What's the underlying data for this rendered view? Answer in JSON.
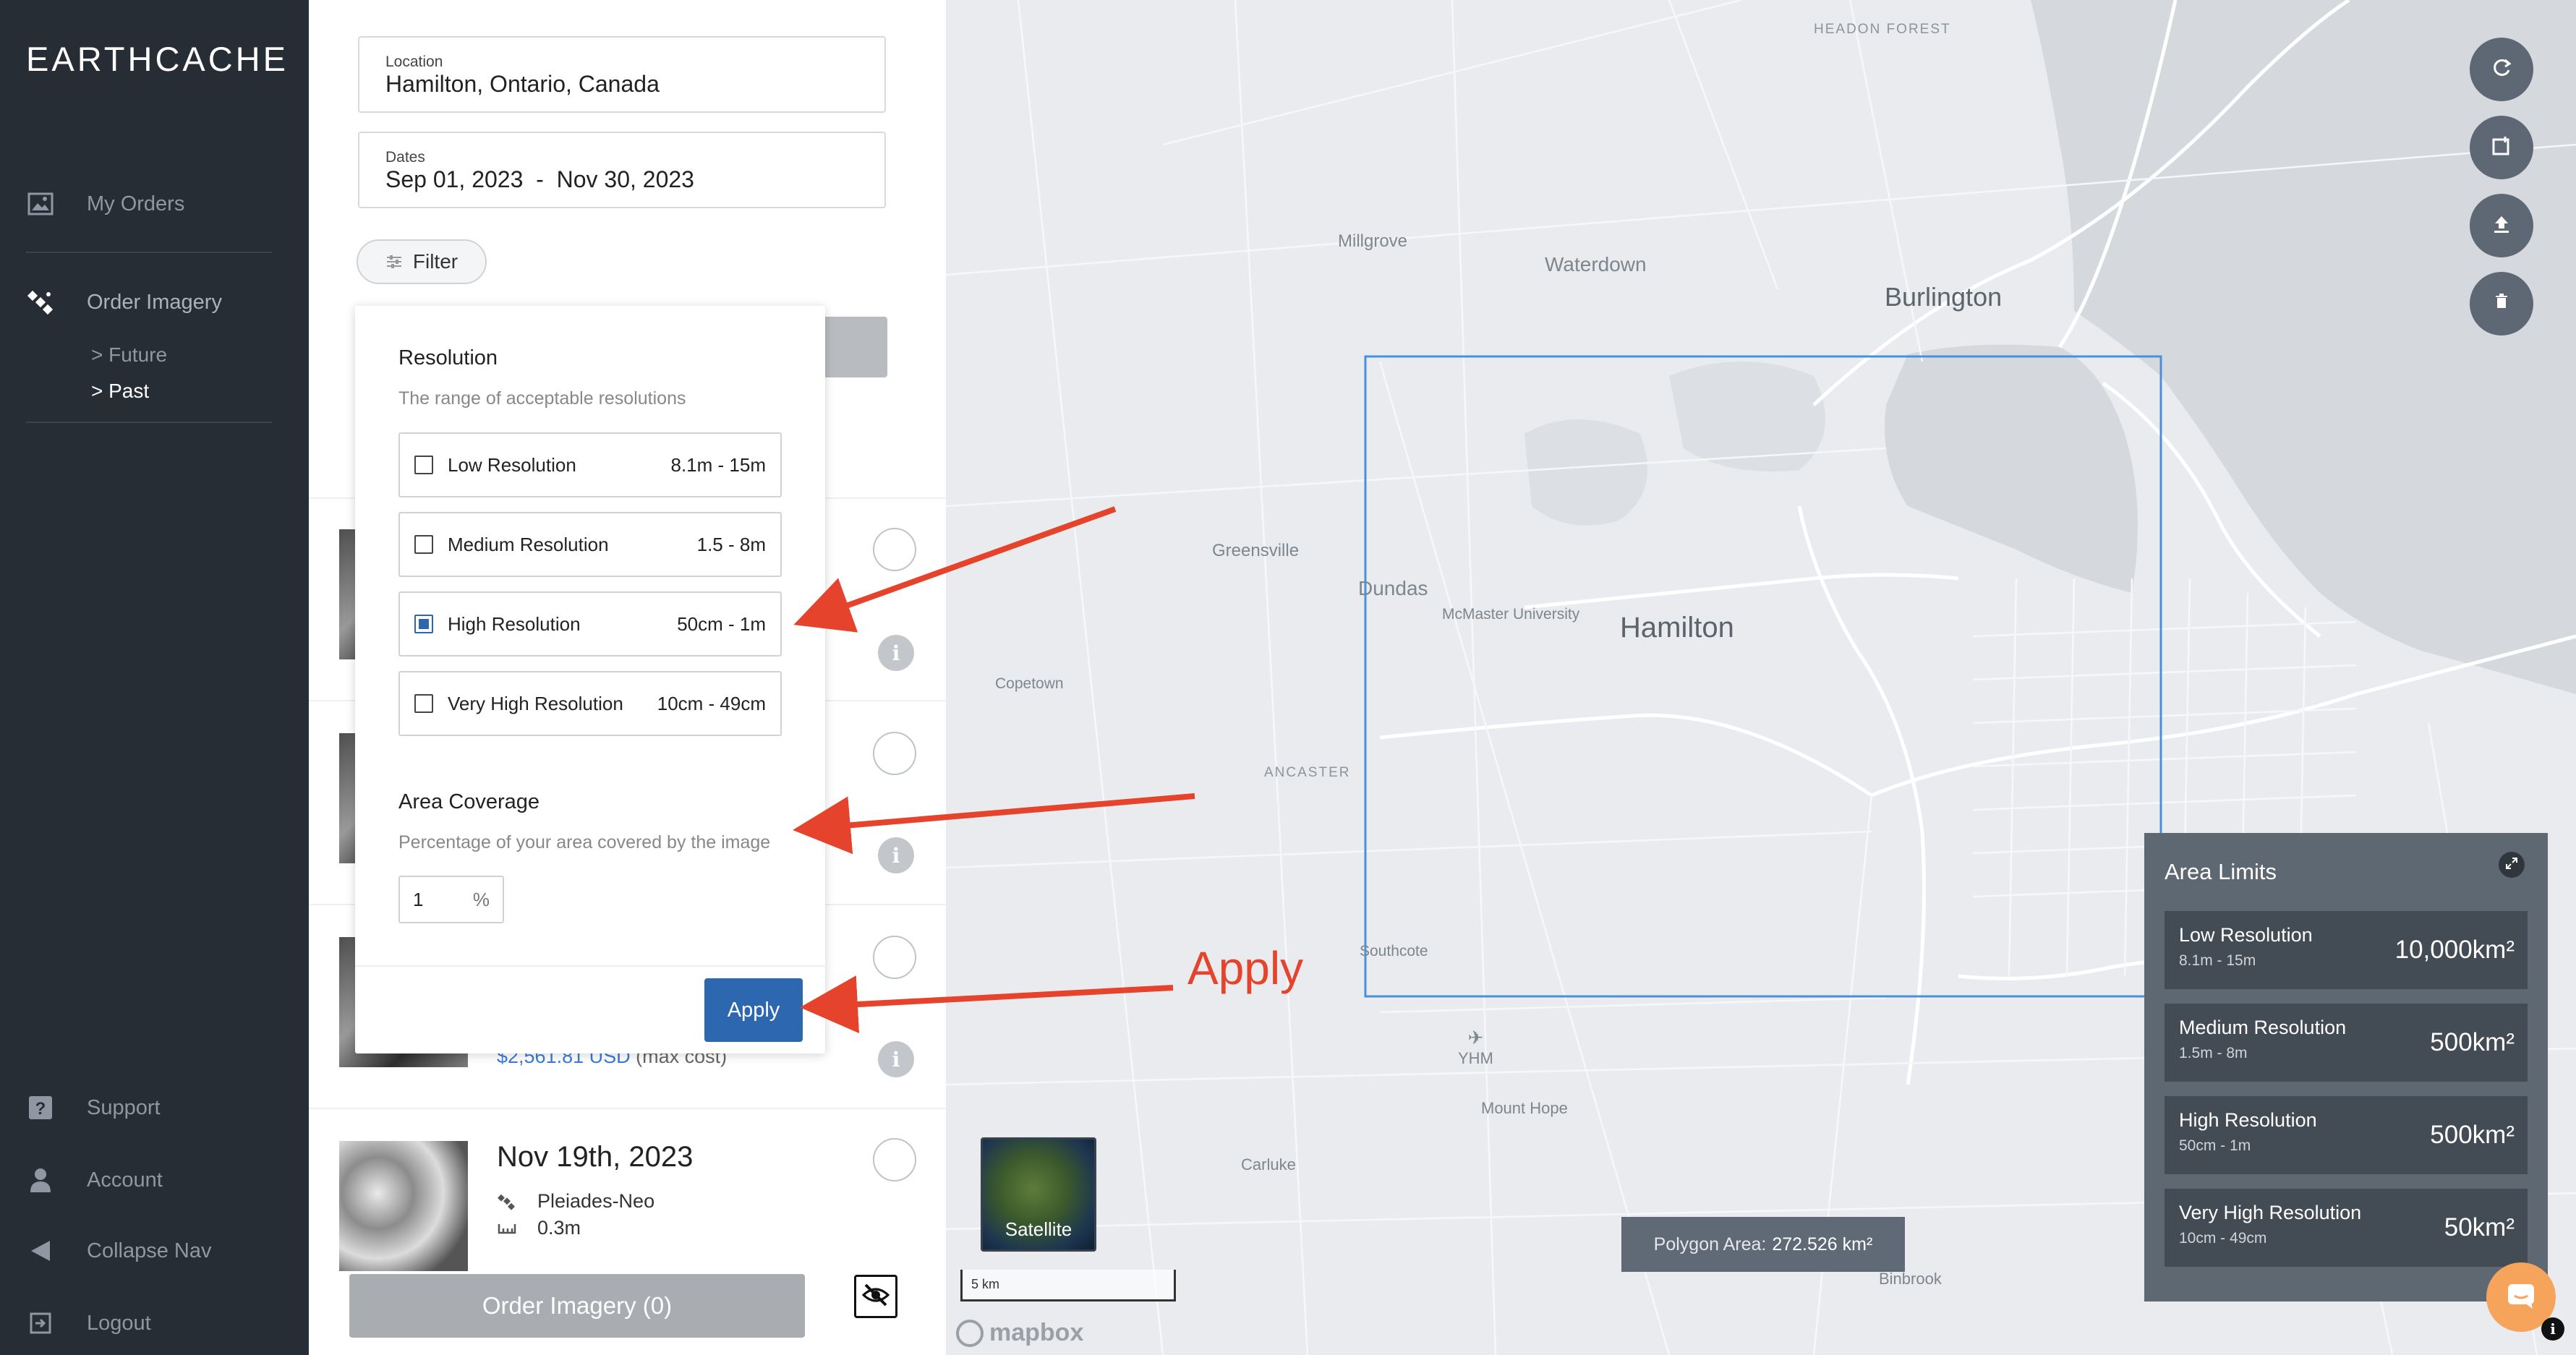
{
  "sidebar": {
    "logo": "EARTHCACHE",
    "nav": [
      {
        "label": "My Orders",
        "icon": "image-icon"
      },
      {
        "label": "Order Imagery",
        "icon": "satellite-icon"
      }
    ],
    "sub_items": [
      "> Future",
      "> Past"
    ],
    "bottom_nav": [
      {
        "label": "Support",
        "icon": "help-icon"
      },
      {
        "label": "Account",
        "icon": "user-icon"
      },
      {
        "label": "Collapse Nav",
        "icon": "collapse-icon"
      },
      {
        "label": "Logout",
        "icon": "logout-icon"
      }
    ]
  },
  "search": {
    "location_label": "Location",
    "location_value": "Hamilton, Ontario, Canada",
    "dates_label": "Dates",
    "dates_value": "Sep 01, 2023  -  Nov 30, 2023",
    "filter_label": "Filter"
  },
  "filter": {
    "resolution_title": "Resolution",
    "resolution_desc": "The range of acceptable resolutions",
    "options": [
      {
        "label": "Low Resolution",
        "range": "8.1m - 15m",
        "checked": false
      },
      {
        "label": "Medium Resolution",
        "range": "1.5 - 8m",
        "checked": false
      },
      {
        "label": "High Resolution",
        "range": "50cm - 1m",
        "checked": true
      },
      {
        "label": "Very High Resolution",
        "range": "10cm - 49cm",
        "checked": false
      }
    ],
    "coverage_title": "Area Coverage",
    "coverage_desc": "Percentage of your area covered by the image",
    "coverage_value": "1",
    "coverage_unit": "%",
    "apply_label": "Apply"
  },
  "results": {
    "price": "$2,561.81 USD",
    "price_note": " (max cost)",
    "last_date": "Nov 19th, 2023",
    "last_satellite": "Pleiades-Neo",
    "last_resolution": "0.3m",
    "order_button": "Order Imagery (0)"
  },
  "map": {
    "labels": {
      "headon": "HEADON FOREST",
      "millgrove": "Millgrove",
      "waterdown": "Waterdown",
      "burlington": "Burlington",
      "greensville": "Greensville",
      "dundas": "Dundas",
      "mcmaster": "McMaster University",
      "hamilton": "Hamilton",
      "copetown": "Copetown",
      "ancaster": "ANCASTER",
      "southcote": "Southcote",
      "yhm": "YHM",
      "mounthope": "Mount Hope",
      "carluke": "Carluke",
      "binbrook": "Binbrook"
    },
    "satellite_label": "Satellite",
    "scale_label": "5 km",
    "mapbox": "mapbox",
    "polygon_area_label": "Polygon Area:",
    "polygon_area_value": "272.526 km²",
    "water_color": "#d5d8dc",
    "selection_color": "#4a90d9"
  },
  "area_limits": {
    "title": "Area Limits",
    "items": [
      {
        "name": "Low Resolution",
        "range": "8.1m - 15m",
        "value": "10,000km²"
      },
      {
        "name": "Medium Resolution",
        "range": "1.5m - 8m",
        "value": "500km²"
      },
      {
        "name": "High Resolution",
        "range": "50cm - 1m",
        "value": "500km²"
      },
      {
        "name": "Very High Resolution",
        "range": "10cm - 49cm",
        "value": "50km²"
      }
    ]
  },
  "annotation": {
    "apply_text": "Apply",
    "arrow_color": "#e5432b"
  }
}
